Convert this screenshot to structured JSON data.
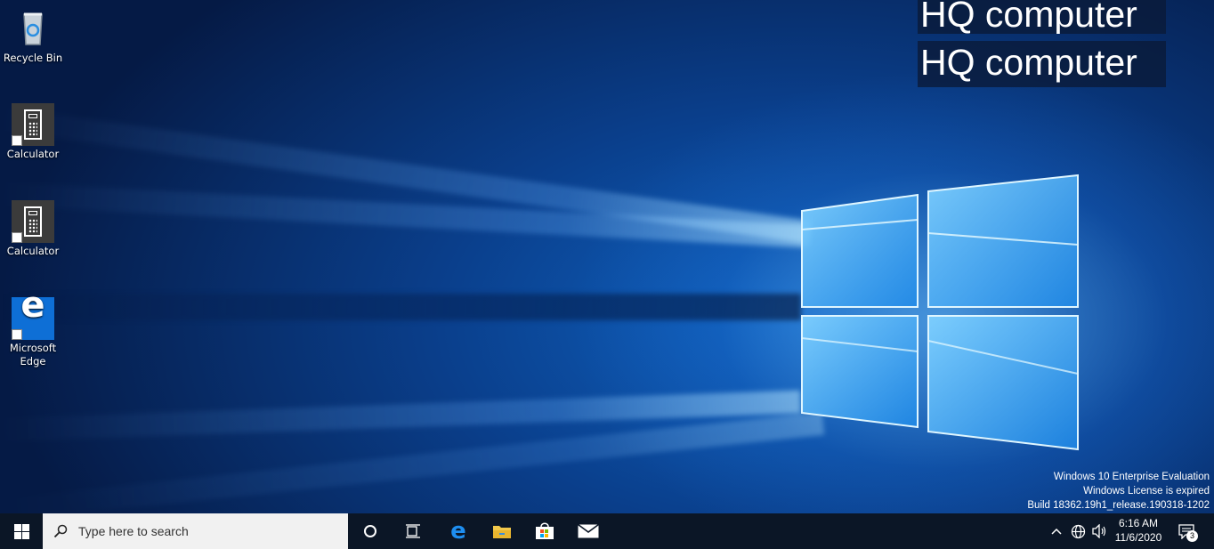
{
  "desktop": {
    "icons": [
      {
        "label": "Recycle Bin"
      },
      {
        "label": "Calculator"
      },
      {
        "label": "Calculator"
      },
      {
        "label": "Microsoft Edge"
      }
    ],
    "watermark_text": [
      "HQ computer",
      "HQ computer"
    ],
    "activation_notice": [
      "Windows 10 Enterprise Evaluation",
      "Windows License is expired",
      "Build 18362.19h1_release.190318-1202"
    ]
  },
  "taskbar": {
    "search_placeholder": "Type here to search",
    "pinned": [
      "start-icon",
      "cortana-icon",
      "task-view-icon",
      "edge-icon",
      "file-explorer-icon",
      "store-icon",
      "mail-icon"
    ],
    "clock": {
      "time": "6:16 AM",
      "date": "11/6/2020"
    },
    "notification_count": "3"
  },
  "colors": {
    "taskbar_bg": "#0b1626",
    "accent": "#0e6fd6",
    "search_bg": "#f1f1f1"
  }
}
